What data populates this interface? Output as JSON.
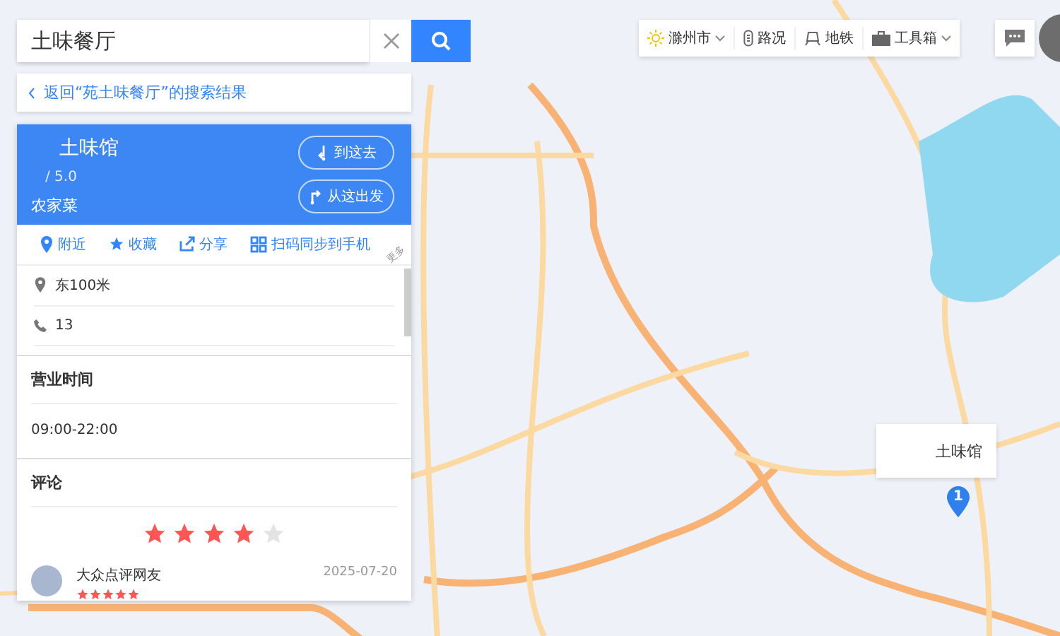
{
  "search": {
    "value": "土味餐厅"
  },
  "back_link": {
    "label": "返回“苑土味餐厅”的搜索结果"
  },
  "place": {
    "name": "土味馆",
    "rating": "/ 5.0",
    "category": "农家菜",
    "buttons": [
      {
        "kind": "to",
        "label": "到这去"
      },
      {
        "kind": "from",
        "label": "从这出发"
      }
    ]
  },
  "actions": [
    {
      "kind": "nearby",
      "label": "附近"
    },
    {
      "kind": "star",
      "label": "收藏"
    },
    {
      "kind": "share",
      "label": "分享"
    },
    {
      "kind": "qr",
      "label": "扫码同步到手机"
    }
  ],
  "corner_tag": "更多",
  "info": [
    {
      "kind": "address",
      "text": "东100米"
    },
    {
      "kind": "phone",
      "text": "13"
    }
  ],
  "hours": {
    "title": "营业时间",
    "text": "09:00-22:00"
  },
  "reviews": {
    "title": "评论",
    "stars": 4,
    "items": [
      {
        "user": "大众点评网友",
        "date": "2025-07-20",
        "stars": 5
      }
    ]
  },
  "toolbar": [
    {
      "kind": "weather",
      "label": "滁州市",
      "dropdown": true
    },
    {
      "kind": "traffic",
      "label": "路况",
      "dropdown": false
    },
    {
      "kind": "metro",
      "label": "地铁",
      "dropdown": false
    },
    {
      "kind": "toolbox",
      "label": "工具箱",
      "dropdown": true
    }
  ],
  "marker": {
    "number": "1",
    "label": "土味馆"
  }
}
